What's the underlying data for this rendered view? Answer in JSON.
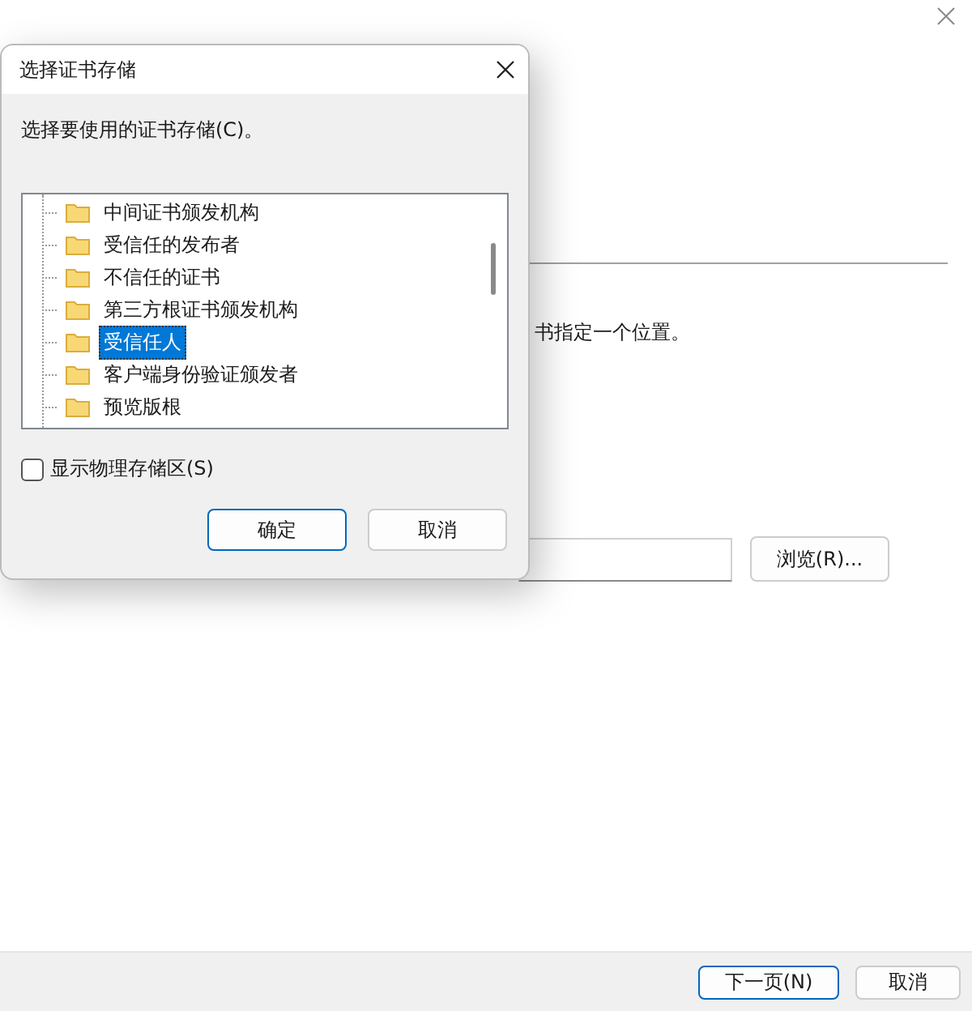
{
  "wizard": {
    "instruction": "书指定一个位置。",
    "browse_button": "浏览(R)...",
    "buttons": [
      {
        "label": "下一页(N)",
        "selected": true
      },
      {
        "label": "取消",
        "selected": false
      }
    ]
  },
  "dialog": {
    "title": "选择证书存储",
    "prompt": "选择要使用的证书存储(C)。",
    "stores": [
      {
        "label": "中间证书颁发机构",
        "selected": false
      },
      {
        "label": "受信任的发布者",
        "selected": false
      },
      {
        "label": "不信任的证书",
        "selected": false
      },
      {
        "label": "第三方根证书颁发机构",
        "selected": false
      },
      {
        "label": "受信任人",
        "selected": true
      },
      {
        "label": "客户端身份验证颁发者",
        "selected": false
      },
      {
        "label": "预览版根",
        "selected": false
      }
    ],
    "show_physical": {
      "label": "显示物理存储区(S)",
      "checked": false
    },
    "buttons": [
      {
        "label": "确定",
        "selected": true
      },
      {
        "label": "取消",
        "selected": false
      }
    ]
  }
}
